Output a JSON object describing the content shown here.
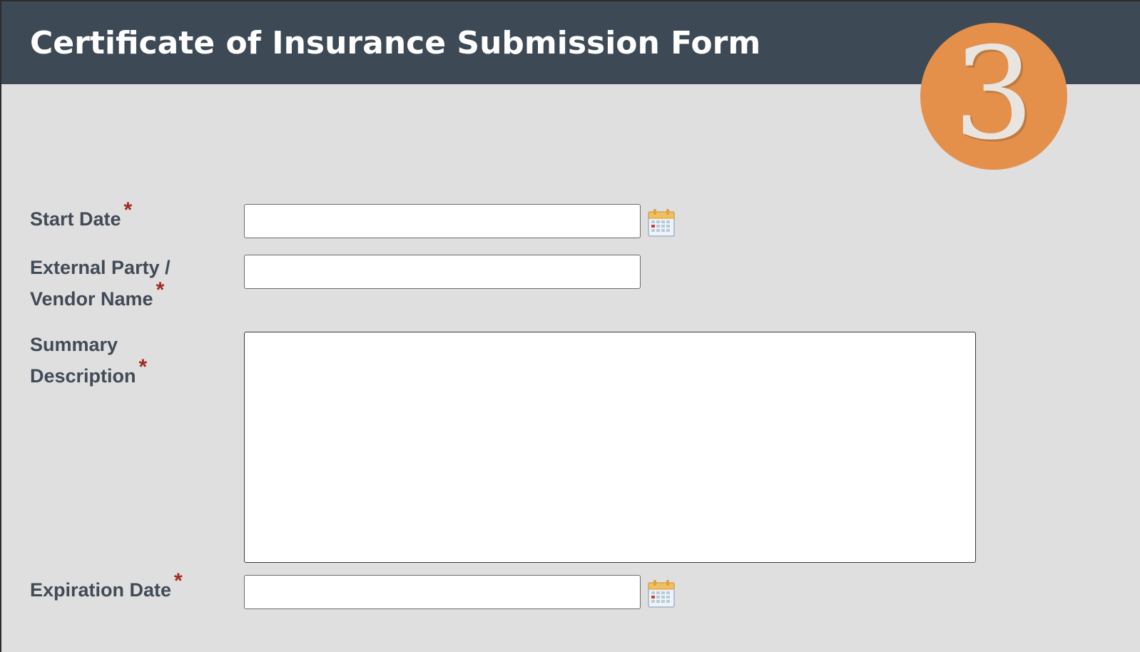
{
  "header": {
    "title": "Certificate of Insurance Submission Form",
    "step_number": "3",
    "step_badge_color": "#e5904a",
    "background_color": "#3d4a56"
  },
  "form": {
    "required_marker": "*",
    "required_marker_color": "#a02a20",
    "fields": {
      "start_date": {
        "label": "Start Date",
        "value": "",
        "icon": "calendar-icon"
      },
      "vendor_name": {
        "label_line1": "External Party /",
        "label_line2": "Vendor Name",
        "value": ""
      },
      "summary_description": {
        "label_line1": "Summary",
        "label_line2": "Description",
        "value": ""
      },
      "expiration_date": {
        "label": "Expiration Date",
        "value": "",
        "icon": "calendar-icon"
      }
    }
  }
}
